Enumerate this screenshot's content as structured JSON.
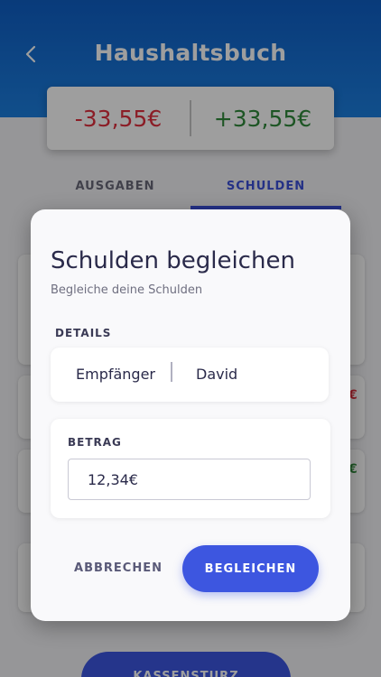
{
  "header": {
    "title": "Haushaltsbuch",
    "back_icon": "chevron-left-icon"
  },
  "balance": {
    "negative": "-33,55€",
    "positive": "+33,55€"
  },
  "tabs": [
    {
      "label": "AUSGABEN",
      "active": false
    },
    {
      "label": "SCHULDEN",
      "active": true
    }
  ],
  "background_peek": {
    "row2_suffix": "€",
    "row3_suffix": "€"
  },
  "bottom_button": {
    "label": "KASSENSTURZ"
  },
  "dialog": {
    "title": "Schulden begleichen",
    "subtitle": "Begleiche deine Schulden",
    "details_label": "DETAILS",
    "details_key": "Empfänger",
    "details_value": "David",
    "amount_label": "BETRAG",
    "amount_value": "12,34€",
    "cancel_label": "ABBRECHEN",
    "confirm_label": "BEGLEICHEN"
  },
  "colors": {
    "header": "#1569d2",
    "accent": "#3d56e0",
    "negative": "#e0303e",
    "positive": "#2f8a3a"
  }
}
